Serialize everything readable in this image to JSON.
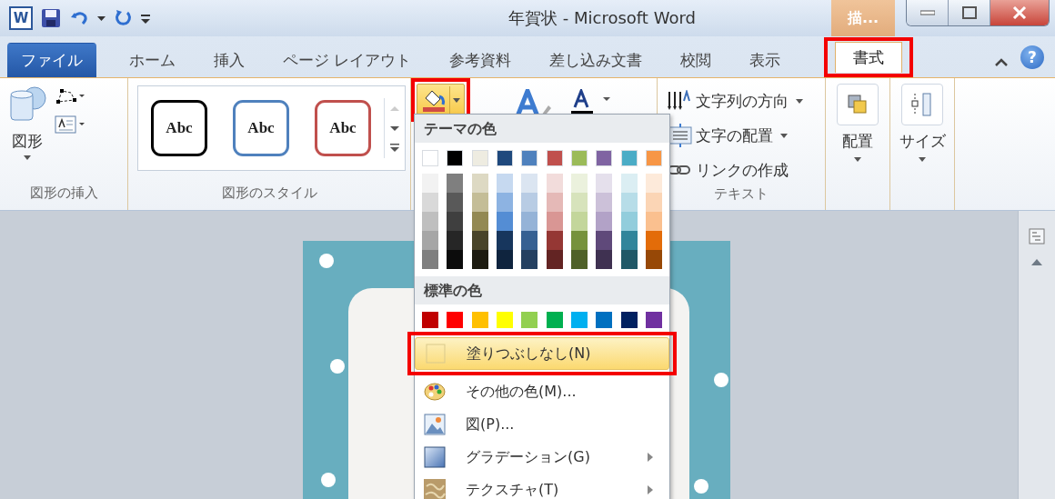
{
  "title_bar": {
    "app_icon": "W",
    "title": "年賀状 - Microsoft Word",
    "context_tab": "描..."
  },
  "tabs": [
    {
      "label": "ファイル",
      "kind": "file",
      "selected": false,
      "callout": false
    },
    {
      "label": "ホーム",
      "kind": "tab",
      "selected": false,
      "callout": false
    },
    {
      "label": "挿入",
      "kind": "tab",
      "selected": false,
      "callout": false
    },
    {
      "label": "ページ レイアウト",
      "kind": "tab",
      "selected": false,
      "callout": false
    },
    {
      "label": "参考資料",
      "kind": "tab",
      "selected": false,
      "callout": false
    },
    {
      "label": "差し込み文書",
      "kind": "tab",
      "selected": false,
      "callout": false
    },
    {
      "label": "校閲",
      "kind": "tab",
      "selected": false,
      "callout": false
    },
    {
      "label": "表示",
      "kind": "tab",
      "selected": false,
      "callout": false
    },
    {
      "label": "書式",
      "kind": "tab",
      "selected": true,
      "callout": true
    }
  ],
  "help": "?",
  "ribbon": {
    "insert_shapes": {
      "label": "図形の挿入",
      "shapes_button": "図形"
    },
    "shape_styles": {
      "label": "図形のスタイル",
      "styles": [
        {
          "text": "Abc",
          "color": "#000000"
        },
        {
          "text": "Abc",
          "color": "#4f81bd"
        },
        {
          "text": "Abc",
          "color": "#c0504d"
        }
      ]
    },
    "fill_button": {
      "pressed": true,
      "callout": true
    },
    "text": {
      "label": "テキスト",
      "items": [
        {
          "label": "文字列の方向",
          "kind": "direction",
          "dropdown": true
        },
        {
          "label": "文字の配置",
          "kind": "align",
          "dropdown": true
        },
        {
          "label": "リンクの作成",
          "kind": "link",
          "dropdown": false
        }
      ]
    },
    "arrange": {
      "label": "配置"
    },
    "size": {
      "label": "サイズ"
    }
  },
  "fill_menu": {
    "theme_header": "テーマの色",
    "theme_rows": [
      [
        {
          "color": "#ffffff"
        },
        {
          "color": "#000000"
        },
        {
          "color": "#eeece1"
        },
        {
          "color": "#1f497d"
        },
        {
          "color": "#4f81bd"
        },
        {
          "color": "#c0504d"
        },
        {
          "color": "#9bbb59"
        },
        {
          "color": "#8064a2"
        },
        {
          "color": "#4bacc6"
        },
        {
          "color": "#f79646"
        }
      ],
      [
        {
          "color": "#f2f2f2"
        },
        {
          "color": "#7f7f7f"
        },
        {
          "color": "#ddd9c3"
        },
        {
          "color": "#c6d9f0"
        },
        {
          "color": "#dbe5f1"
        },
        {
          "color": "#f2dcdb"
        },
        {
          "color": "#ebf1dd"
        },
        {
          "color": "#e5e0ec"
        },
        {
          "color": "#dbeef3"
        },
        {
          "color": "#fdeada"
        }
      ],
      [
        {
          "color": "#d9d9d9"
        },
        {
          "color": "#595959"
        },
        {
          "color": "#c4bd97"
        },
        {
          "color": "#8db3e2"
        },
        {
          "color": "#b8cce4"
        },
        {
          "color": "#e5b9b7"
        },
        {
          "color": "#d7e3bc"
        },
        {
          "color": "#ccc1d9"
        },
        {
          "color": "#b7dde8"
        },
        {
          "color": "#fbd5b5"
        }
      ],
      [
        {
          "color": "#bfbfbf"
        },
        {
          "color": "#3f3f3f"
        },
        {
          "color": "#938953"
        },
        {
          "color": "#548dd4"
        },
        {
          "color": "#95b3d7"
        },
        {
          "color": "#d99694"
        },
        {
          "color": "#c3d69b"
        },
        {
          "color": "#b2a2c7"
        },
        {
          "color": "#92cddc"
        },
        {
          "color": "#fac08f"
        }
      ],
      [
        {
          "color": "#a6a6a6"
        },
        {
          "color": "#262626"
        },
        {
          "color": "#494429"
        },
        {
          "color": "#17365d"
        },
        {
          "color": "#366092"
        },
        {
          "color": "#953734"
        },
        {
          "color": "#76923c"
        },
        {
          "color": "#5f497a"
        },
        {
          "color": "#31859b"
        },
        {
          "color": "#e36c09"
        }
      ],
      [
        {
          "color": "#7f7f7f"
        },
        {
          "color": "#0c0c0c"
        },
        {
          "color": "#1d1b10"
        },
        {
          "color": "#0f243e"
        },
        {
          "color": "#244061"
        },
        {
          "color": "#632423"
        },
        {
          "color": "#4f6128"
        },
        {
          "color": "#3f3151"
        },
        {
          "color": "#205867"
        },
        {
          "color": "#974806"
        }
      ]
    ],
    "standard_header": "標準の色",
    "standard_colors": [
      {
        "color": "#c00000"
      },
      {
        "color": "#ff0000"
      },
      {
        "color": "#ffc000"
      },
      {
        "color": "#ffff00"
      },
      {
        "color": "#92d050"
      },
      {
        "color": "#00b050"
      },
      {
        "color": "#00b0f0"
      },
      {
        "color": "#0070c0"
      },
      {
        "color": "#002060"
      },
      {
        "color": "#7030a0"
      }
    ],
    "items": [
      {
        "label": "塗りつぶしなし(N)",
        "kind": "none",
        "selected": true,
        "callout": true,
        "submenu": false
      },
      {
        "label": "その他の色(M)...",
        "kind": "palette",
        "selected": false,
        "callout": false,
        "submenu": false
      },
      {
        "label": "図(P)...",
        "kind": "picture",
        "selected": false,
        "callout": false,
        "submenu": false
      },
      {
        "label": "グラデーション(G)",
        "kind": "gradient",
        "selected": false,
        "callout": false,
        "submenu": true
      },
      {
        "label": "テクスチャ(T)",
        "kind": "texture",
        "selected": false,
        "callout": false,
        "submenu": true
      }
    ]
  }
}
